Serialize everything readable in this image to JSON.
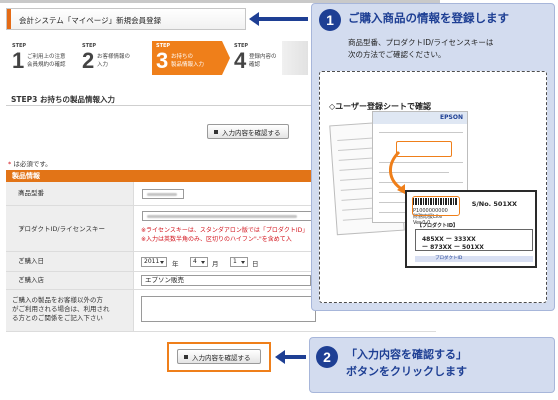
{
  "window": {
    "title": "会計システム「マイページ」新規会員登録"
  },
  "steps": [
    {
      "label": "STEP",
      "num": "1",
      "desc_lines": [
        "ご利用上の注意",
        "会員規約の確認"
      ],
      "active": false
    },
    {
      "label": "STEP",
      "num": "2",
      "desc_lines": [
        "お客様情報の",
        "入力"
      ],
      "active": false
    },
    {
      "label": "STEP",
      "num": "3",
      "desc_lines": [
        "お持ちの",
        "製品情報入力"
      ],
      "active": true
    },
    {
      "label": "STEP",
      "num": "4",
      "desc_lines": [
        "登録内容の",
        "確認"
      ],
      "active": false
    }
  ],
  "section": {
    "heading": "STEP3  お持ちの製品情報入力"
  },
  "confirm_button": {
    "label": "入力内容を確認する"
  },
  "required_note": {
    "star": "*",
    "text": " は必須です。"
  },
  "product_table": {
    "heading": "製品情報",
    "rows": {
      "model": {
        "label": "商品型番",
        "required": "*"
      },
      "product_id": {
        "label": "プロダクトID/ライセンスキー",
        "required": "*",
        "note1": "※ライセンスキーは、スタンダアロン版では「プロダクトID」",
        "note2": "※入力は英数半角のみ、区切りのハイフン\"-\"を含めて入"
      },
      "purchase_date": {
        "label": "ご購入日",
        "required": "*",
        "year": "2011",
        "year_unit": "年",
        "month": "4",
        "month_unit": "月",
        "day": "1",
        "day_unit": "日"
      },
      "store": {
        "label": "ご購入店",
        "required": "*",
        "value": "エプソン販売"
      },
      "other_user": {
        "label_lines": [
          "ご購入の製品をお客様以外の方",
          "がご利用される場合は、利用され",
          "る方とのご関係をご記入下さい"
        ]
      }
    }
  },
  "callout1": {
    "number": "1",
    "heading": "ご購入商品の情報を登録します",
    "body_lines": [
      "商品型番、プロダクトID/ライセンスキーは",
      "次の方法でご確認ください。"
    ],
    "inner_title": "◇ユーザー登録シートで確認",
    "sheet_logo": "EPSON",
    "card": {
      "serial": "S/No. 501XX",
      "small_lines": [
        "P1000000000",
        "財務応援Lite",
        "Ver.0.0"
      ],
      "code_header": "【プロダクトID】",
      "code_line1": "485XX  ー  333XX",
      "code_line2": "ー  873XX  ー  501XX",
      "band": "プロダクトID"
    }
  },
  "callout2": {
    "number": "2",
    "heading_lines": [
      "「入力内容を確認する」",
      "ボタンをクリックします"
    ]
  },
  "colors": {
    "accent": "#ef7f1a",
    "navy": "#1e3f94",
    "callout_bg": "#d3dcef",
    "required": "#d2121b"
  }
}
